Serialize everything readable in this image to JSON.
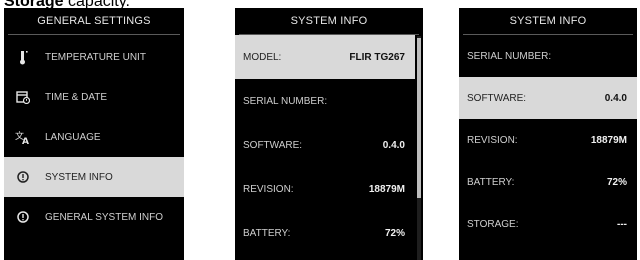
{
  "caption": {
    "bold_text": "Storage",
    "text": " capacity."
  },
  "menu_screen": {
    "title": "GENERAL SETTINGS",
    "items": [
      {
        "label": "TEMPERATURE UNIT",
        "icon": "thermometer-icon",
        "selected": false
      },
      {
        "label": "TIME & DATE",
        "icon": "calendar-clock-icon",
        "selected": false
      },
      {
        "label": "LANGUAGE",
        "icon": "language-icon",
        "selected": false
      },
      {
        "label": "SYSTEM INFO",
        "icon": "info-circle-icon",
        "selected": true
      },
      {
        "label": "GENERAL SYSTEM INFO",
        "icon": "info-circle-icon",
        "selected": false
      }
    ]
  },
  "info_screen_1": {
    "title": "SYSTEM INFO",
    "rows": [
      {
        "label": "MODEL:",
        "value": "FLIR TG267",
        "selected": true
      },
      {
        "label": "SERIAL NUMBER:",
        "value": "",
        "selected": false
      },
      {
        "label": "SOFTWARE:",
        "value": "0.4.0",
        "selected": false
      },
      {
        "label": "REVISION:",
        "value": "18879M",
        "selected": false
      },
      {
        "label": "BATTERY:",
        "value": "72%",
        "selected": false
      }
    ]
  },
  "info_screen_2": {
    "title": "SYSTEM INFO",
    "rows": [
      {
        "label": "SERIAL NUMBER:",
        "value": "",
        "selected": false
      },
      {
        "label": "SOFTWARE:",
        "value": "0.4.0",
        "selected": true
      },
      {
        "label": "REVISION:",
        "value": "18879M",
        "selected": false
      },
      {
        "label": "BATTERY:",
        "value": "72%",
        "selected": false
      },
      {
        "label": "STORAGE:",
        "value": "---",
        "selected": false
      }
    ]
  },
  "colors": {
    "screen_bg": "#000000",
    "highlight": "#d9d9d9",
    "text": "#cfcfcf"
  }
}
